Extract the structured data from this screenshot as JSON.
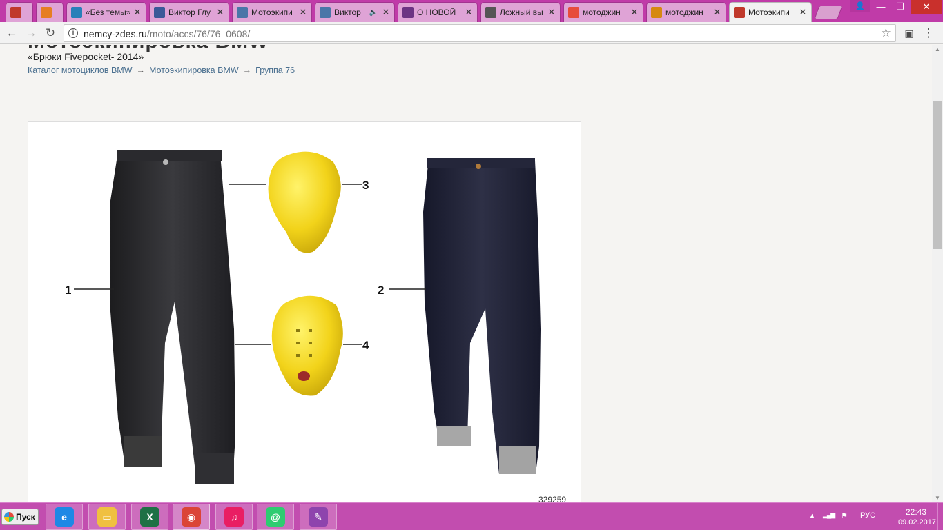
{
  "browser": {
    "tabs": [
      {
        "title": "",
        "icon": "briefcase-icon",
        "color": "#c0392b"
      },
      {
        "title": "",
        "icon": "basket-icon",
        "color": "#e67e22"
      },
      {
        "title": "«Без темы»",
        "icon": "mail-at-icon",
        "color": "#2980b9"
      },
      {
        "title": "Виктор Глу",
        "icon": "facebook-icon",
        "color": "#3b5998"
      },
      {
        "title": "Мотоэкипи",
        "icon": "vk-icon",
        "color": "#4a76a8"
      },
      {
        "title": "Виктор",
        "icon": "vk-icon",
        "color": "#4a76a8",
        "audio": "🔈"
      },
      {
        "title": "О НОВОЙ",
        "icon": "person-icon",
        "color": "#6c3483"
      },
      {
        "title": "Ложный вы",
        "icon": "bag-icon",
        "color": "#555555"
      },
      {
        "title": "мотоджин",
        "icon": "yandex-icon",
        "color": "#e74c3c"
      },
      {
        "title": "мотоджин",
        "icon": "image-icon",
        "color": "#d68910"
      },
      {
        "title": "Мотоэкипи",
        "icon": "site-icon",
        "color": "#c0392b"
      }
    ],
    "close_glyph": "✕",
    "window_controls": {
      "user": "👤",
      "minimize": "—",
      "maximize": "❐",
      "close": "✕"
    },
    "nav": {
      "back": "←",
      "forward": "→",
      "reload": "↻",
      "menu": "⋮"
    },
    "url_host": "nemcy-zdes.ru",
    "url_path": "/moto/accs/76/76_0608/",
    "info_glyph": "i",
    "star_glyph": "☆"
  },
  "page": {
    "heading": "Мотоэкипировка BMW",
    "subtitle": "«Брюки Fivepocket- 2014»",
    "breadcrumb": [
      "Каталог мотоциклов BMW",
      "Мотоэкипировка BMW",
      "Группа 76"
    ],
    "breadcrumb_sep": "→",
    "part_labels": [
      "1",
      "2",
      "3",
      "4"
    ],
    "part_code": "329259"
  },
  "scrollbar": {
    "up": "▲",
    "down": "▼"
  },
  "taskbar": {
    "start_label": "Пуск",
    "apps": [
      {
        "name": "internet-explorer",
        "glyph": "e",
        "color": "#1e88e5"
      },
      {
        "name": "file-explorer",
        "glyph": "▭",
        "color": "#f0c040"
      },
      {
        "name": "excel",
        "glyph": "X",
        "color": "#1e7145"
      },
      {
        "name": "chrome",
        "glyph": "◉",
        "color": "#db4437"
      },
      {
        "name": "itunes",
        "glyph": "♫",
        "color": "#e91e63"
      },
      {
        "name": "mail-agent",
        "glyph": "@",
        "color": "#2ecc71"
      },
      {
        "name": "paint",
        "glyph": "✎",
        "color": "#8e44ad"
      }
    ],
    "tray": {
      "arrow": "▲",
      "signal": "▂▄▆",
      "flag": "⚑",
      "lang": "РУС",
      "time": "22:43",
      "date": "09.02.2017"
    }
  }
}
